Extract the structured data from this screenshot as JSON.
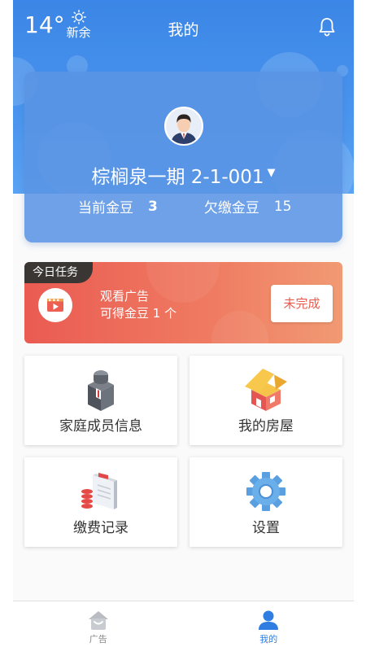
{
  "header": {
    "title": "我的",
    "weather": {
      "temperature": "14°",
      "city": "新余",
      "icon": "sun-icon"
    },
    "notification_icon": "bell-icon"
  },
  "profile": {
    "avatar_icon": "person-avatar",
    "address": "棕榈泉一期 2-1-001",
    "current_beans_label": "当前金豆",
    "current_beans_value": "3",
    "owed_beans_label": "欠缴金豆",
    "owed_beans_value": "15"
  },
  "task": {
    "tag": "今日任务",
    "line1": "观看广告",
    "line2": "可得金豆 1 个",
    "status_button": "未完成",
    "icon": "video-play-icon"
  },
  "tiles": [
    {
      "label": "家庭成员信息",
      "icon": "family-members-icon"
    },
    {
      "label": "我的房屋",
      "icon": "house-icon"
    },
    {
      "label": "缴费记录",
      "icon": "payment-record-icon"
    },
    {
      "label": "设置",
      "icon": "gear-icon"
    }
  ],
  "tabbar": {
    "items": [
      {
        "label": "广告",
        "icon": "home-icon",
        "active": false
      },
      {
        "label": "我的",
        "icon": "user-icon",
        "active": true
      }
    ]
  },
  "colors": {
    "primary": "#3b86e6",
    "task_gradient_start": "#ea5b52",
    "task_gradient_end": "#f19a74",
    "active_tab": "#2f7de1"
  }
}
